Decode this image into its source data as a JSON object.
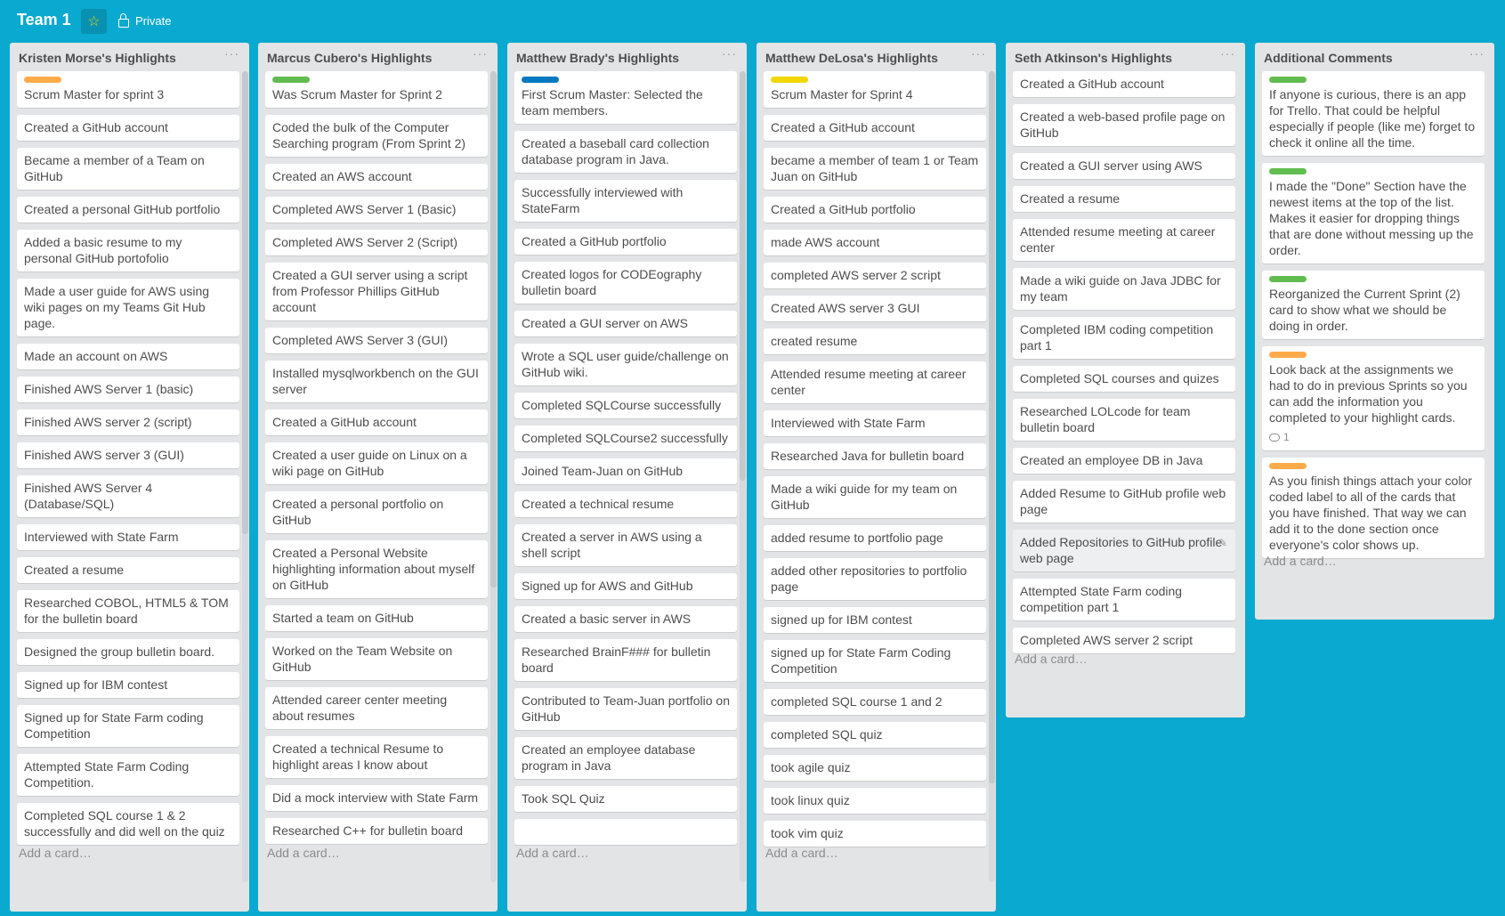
{
  "board": {
    "title": "Team 1",
    "visibility": "Private",
    "star_icon": "star-icon",
    "colors": {
      "background": "#0aa9cf",
      "list_bg": "#e2e4e6",
      "label_orange": "#ffab4a",
      "label_green": "#61bd4f",
      "label_blue": "#0079bf",
      "label_yellow": "#f2d600"
    }
  },
  "add_card_text": "Add a card…",
  "lists": [
    {
      "title": "Kristen Morse's Highlights",
      "cards": [
        {
          "text": "Scrum Master for sprint 3",
          "label": "#ffab4a"
        },
        {
          "text": "Created a GitHub account"
        },
        {
          "text": "Became a member of a Team on GitHub"
        },
        {
          "text": "Created a personal GitHub portfolio"
        },
        {
          "text": "Added a basic resume to my personal GitHub portofolio"
        },
        {
          "text": "Made a user guide for AWS using wiki pages on my Teams Git Hub page."
        },
        {
          "text": "Made an account on AWS"
        },
        {
          "text": "Finished AWS Server 1 (basic)"
        },
        {
          "text": "Finished AWS server 2 (script)"
        },
        {
          "text": "Finished AWS server 3 (GUI)"
        },
        {
          "text": "Finished AWS Server 4 (Database/SQL)"
        },
        {
          "text": "Interviewed with State Farm"
        },
        {
          "text": "Created a resume"
        },
        {
          "text": "Researched COBOL, HTML5 & TOM for the bulletin board"
        },
        {
          "text": "Designed the group bulletin board."
        },
        {
          "text": "Signed up for IBM contest"
        },
        {
          "text": "Signed up for State Farm coding Competition"
        },
        {
          "text": "Attempted State Farm Coding Competition."
        },
        {
          "text": "Completed SQL course 1 & 2 successfully and did well on the quiz"
        }
      ]
    },
    {
      "title": "Marcus Cubero's Highlights",
      "cards": [
        {
          "text": "Was Scrum Master for Sprint 2",
          "label": "#61bd4f"
        },
        {
          "text": "Coded the bulk of the Computer Searching program (From Sprint 2)"
        },
        {
          "text": "Created an AWS account"
        },
        {
          "text": "Completed AWS Server 1 (Basic)"
        },
        {
          "text": "Completed AWS Server 2 (Script)"
        },
        {
          "text": "Created a GUI server using a script from Professor Phillips GitHub account"
        },
        {
          "text": "Completed AWS Server 3 (GUI)"
        },
        {
          "text": "Installed mysqlworkbench on the GUI server"
        },
        {
          "text": "Created a GitHub account"
        },
        {
          "text": "Created a user guide on Linux on a wiki page on GitHub"
        },
        {
          "text": "Created a personal portfolio on GitHub"
        },
        {
          "text": "Created a Personal Website highlighting information about myself on GitHub"
        },
        {
          "text": "Started a team on GitHub"
        },
        {
          "text": "Worked on the Team Website on GitHub"
        },
        {
          "text": "Attended career center meeting about resumes"
        },
        {
          "text": "Created a technical Resume to highlight areas I know about"
        },
        {
          "text": "Did a mock interview with State Farm"
        },
        {
          "text": "Researched C++ for bulletin board"
        }
      ]
    },
    {
      "title": "Matthew Brady's Highlights",
      "cards": [
        {
          "text": "First Scrum Master: Selected the team members.",
          "label": "#0079bf"
        },
        {
          "text": "Created a baseball card collection database program in Java."
        },
        {
          "text": "Successfully interviewed with StateFarm"
        },
        {
          "text": "Created a GitHub portfolio"
        },
        {
          "text": "Created logos for CODEography bulletin board"
        },
        {
          "text": "Created a GUI server on AWS"
        },
        {
          "text": "Wrote a SQL user guide/challenge on GitHub wiki."
        },
        {
          "text": "Completed SQLCourse successfully"
        },
        {
          "text": "Completed SQLCourse2 successfully"
        },
        {
          "text": "Joined Team-Juan on GitHub"
        },
        {
          "text": "Created a technical resume"
        },
        {
          "text": "Created a server in AWS using a shell script"
        },
        {
          "text": "Signed up for AWS and GitHub"
        },
        {
          "text": "Created a basic server in AWS"
        },
        {
          "text": "Researched BrainF### for bulletin board"
        },
        {
          "text": "Contributed to Team-Juan portfolio on GitHub"
        },
        {
          "text": "Created an employee database program in Java"
        },
        {
          "text": "Took SQL Quiz"
        },
        {
          "text": ""
        }
      ]
    },
    {
      "title": "Matthew DeLosa's Highlights",
      "cards": [
        {
          "text": "Scrum Master for Sprint 4",
          "label": "#f2d600"
        },
        {
          "text": "Created a GitHub account"
        },
        {
          "text": "became a member of team 1 or Team Juan on GitHub"
        },
        {
          "text": "Created a GitHub portfolio"
        },
        {
          "text": "made AWS account"
        },
        {
          "text": "completed AWS server 2 script"
        },
        {
          "text": "Created AWS server 3 GUI"
        },
        {
          "text": "created resume"
        },
        {
          "text": "Attended resume meeting at career center"
        },
        {
          "text": "Interviewed with State Farm"
        },
        {
          "text": "Researched Java for bulletin board"
        },
        {
          "text": "Made a wiki guide for my team on GitHub"
        },
        {
          "text": "added resume to portfolio page"
        },
        {
          "text": "added other repositories to portfolio page"
        },
        {
          "text": "signed up for IBM contest"
        },
        {
          "text": "signed up for State Farm Coding Competition"
        },
        {
          "text": "completed SQL course 1 and 2"
        },
        {
          "text": "completed SQL quiz"
        },
        {
          "text": "took agile quiz"
        },
        {
          "text": "took linux quiz"
        },
        {
          "text": "took vim quiz"
        }
      ]
    },
    {
      "title": "Seth Atkinson's Highlights",
      "cards": [
        {
          "text": "Created a GitHub account"
        },
        {
          "text": "Created a web-based profile page on GitHub"
        },
        {
          "text": "Created a GUI server using AWS"
        },
        {
          "text": "Created a resume"
        },
        {
          "text": "Attended resume meeting at career center"
        },
        {
          "text": "Made a wiki guide on Java JDBC for my team"
        },
        {
          "text": "Completed IBM coding competition part 1"
        },
        {
          "text": "Completed SQL courses and quizes"
        },
        {
          "text": "Researched LOLcode for team bulletin board"
        },
        {
          "text": "Created an employee DB in Java"
        },
        {
          "text": "Added Resume to GitHub profile web page"
        },
        {
          "text": "Added Repositories to GitHub profile web page",
          "hover": true
        },
        {
          "text": "Attempted State Farm coding competition part 1"
        },
        {
          "text": "Completed AWS server 2 script"
        }
      ]
    },
    {
      "title": "Additional Comments",
      "cards": [
        {
          "text": "If anyone is curious, there is an app for Trello. That could be helpful especially if people (like me) forget to check it online all the time.",
          "label": "#61bd4f"
        },
        {
          "text": "I made the \"Done\" Section have the newest items at the top of the list. Makes it easier for dropping things that are done without messing up the order.",
          "label": "#61bd4f"
        },
        {
          "text": "Reorganized the Current Sprint (2) card to show what we should be doing in order.",
          "label": "#61bd4f"
        },
        {
          "text": "Look back at the assignments we had to do in previous Sprints so you can add the information you completed to your highlight cards.",
          "label": "#ffab4a",
          "comments": "1"
        },
        {
          "text": "As you finish things attach your color coded label to all of the cards that you have finished. That way we can add it to the done section once everyone's color shows up.",
          "label": "#ffab4a"
        }
      ]
    }
  ]
}
